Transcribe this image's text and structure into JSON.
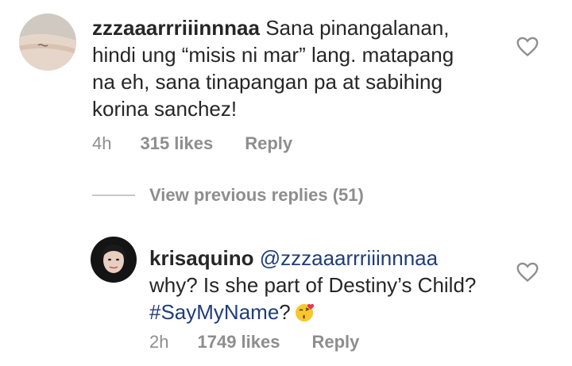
{
  "comment1": {
    "username": "zzzaaarrriiinnnaa",
    "text_line1": " Sana pinangalanan,",
    "text_line2": "hindi ung “misis ni mar” lang. matapang",
    "text_line3": "na eh, sana tinapangan pa at sabihing",
    "text_line4": "korina sanchez!",
    "time": "4h",
    "likes": "315 likes",
    "reply": "Reply"
  },
  "view_previous": "View previous replies (51)",
  "comment2": {
    "username": "krisaquino",
    "mention": "@zzzaaarrriiinnnaa",
    "text_line1": "why? Is she part of Destiny’s Child?",
    "hashtag": "#SayMyName",
    "text_after_hashtag": "?",
    "time": "2h",
    "likes": "1749 likes",
    "reply": "Reply"
  },
  "icons": {
    "like": "heart-outline-icon",
    "emoji": "kissing-face-with-heart-emoji"
  }
}
